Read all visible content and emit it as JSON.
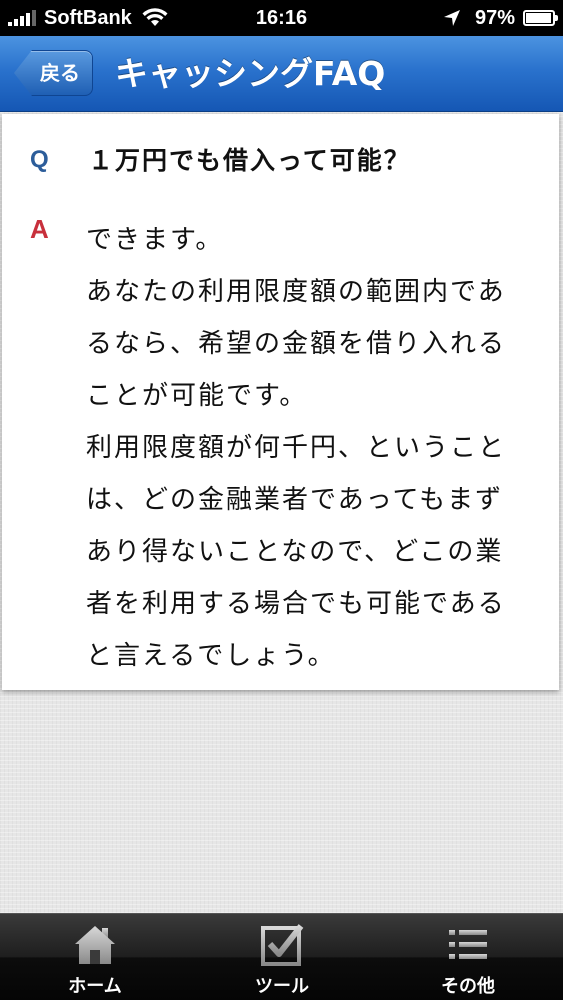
{
  "status_bar": {
    "carrier": "SoftBank",
    "time": "16:16",
    "battery_text": "97%",
    "battery_level": 0.97
  },
  "nav": {
    "back_label": "戻る",
    "title": "キャッシングFAQ"
  },
  "faq": {
    "q_mark": "Q",
    "question": "１万円でも借入って可能？",
    "a_mark": "A",
    "answer_lines": [
      "できます。",
      "あなたの利用限度額の範囲内であ",
      "るなら、希望の金額を借り入れる",
      "ことが可能です。",
      "利用限度額が何千円、ということ",
      "は、どの金融業者であってもまず",
      "あり得ないことなので、どこの業",
      "者を利用する場合でも可能である",
      "と言えるでしょう。"
    ]
  },
  "tabs": [
    {
      "label": "ホーム",
      "icon": "home-icon"
    },
    {
      "label": "ツール",
      "icon": "checkbox-icon"
    },
    {
      "label": "その他",
      "icon": "list-icon"
    }
  ],
  "colors": {
    "nav_blue": "#2a72cd",
    "q_color": "#2c5d9a",
    "a_color": "#c8303c"
  }
}
